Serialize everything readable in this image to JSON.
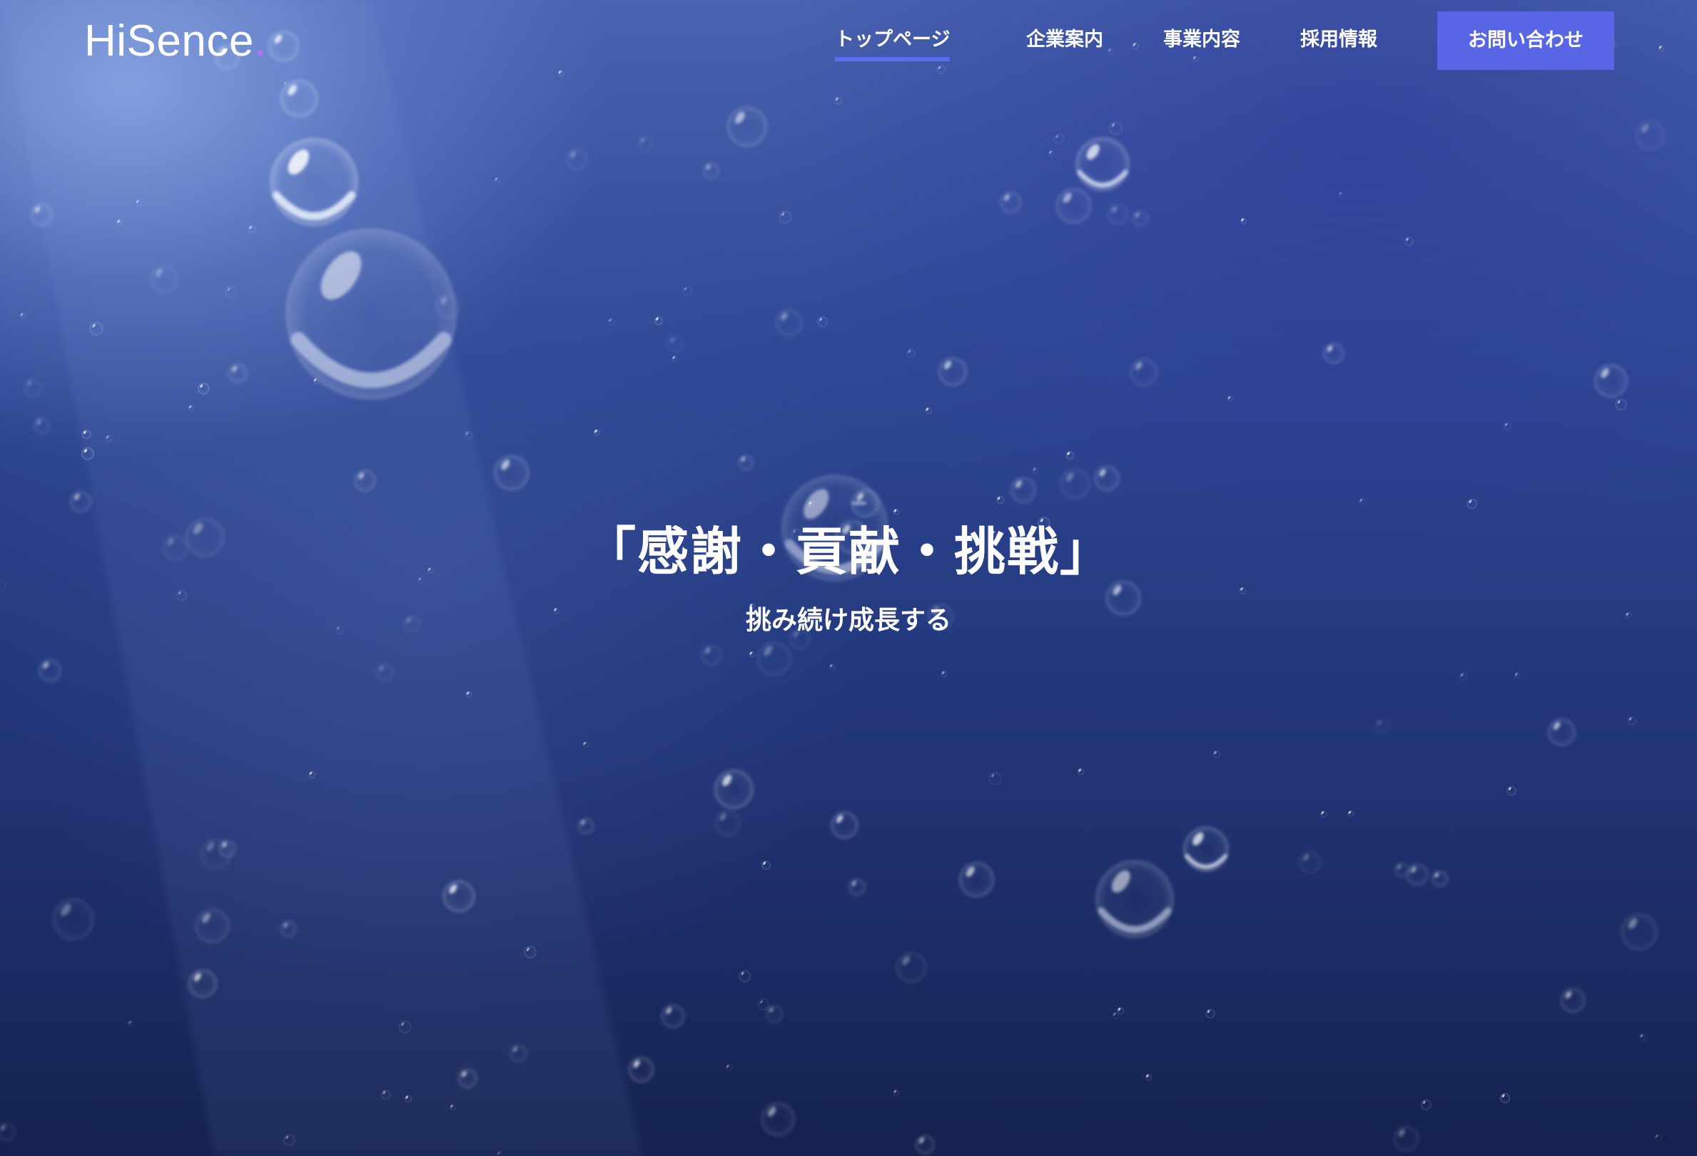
{
  "brand": {
    "name": "HiSence",
    "dot": ".",
    "dot_color": "#c06cff"
  },
  "nav": {
    "items": [
      {
        "label": "トップページ",
        "active": true
      },
      {
        "label": "企業案内",
        "active": false
      },
      {
        "label": "事業内容",
        "active": false
      },
      {
        "label": "採用情報",
        "active": false
      }
    ],
    "contact_label": "お問い合わせ",
    "accent_color": "#5866e6"
  },
  "hero": {
    "background": "underwater-bubbles",
    "headline": "「感謝・貢献・挑戦」",
    "subline": "挑み続け成長する"
  }
}
